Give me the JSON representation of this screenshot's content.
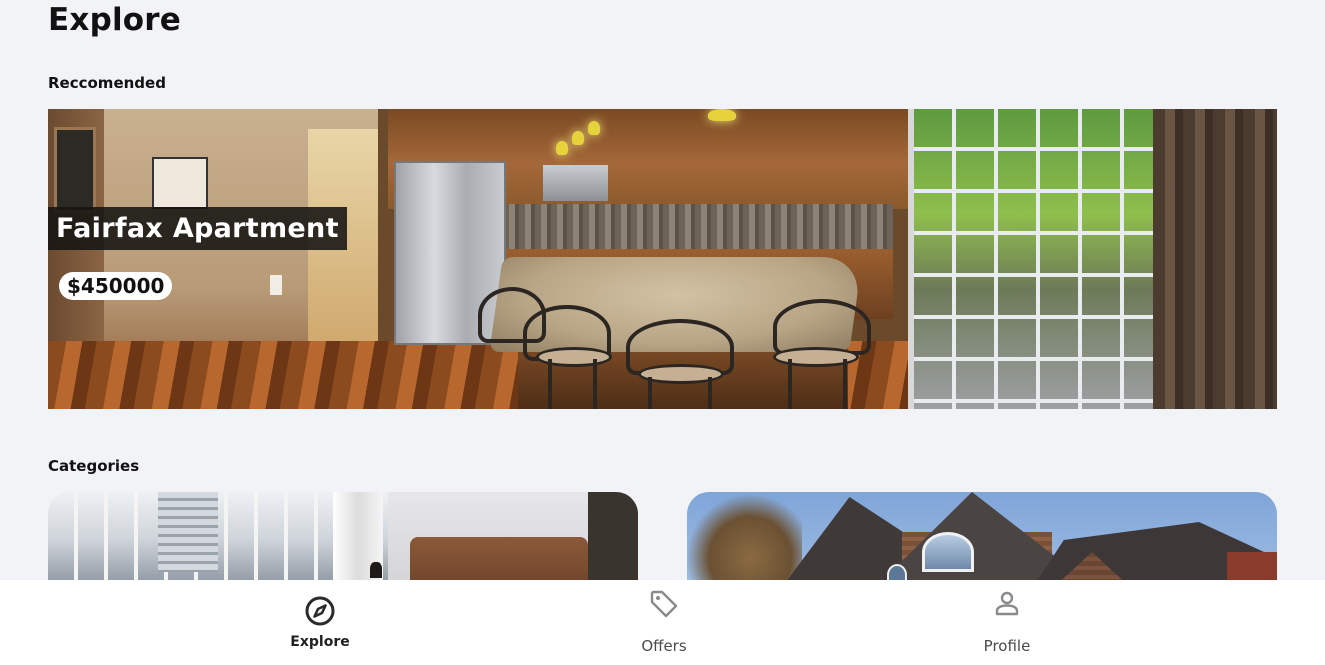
{
  "header": {
    "title": "Explore"
  },
  "sections": {
    "recommended_label": "Reccomended",
    "categories_label": "Categories"
  },
  "featured": {
    "name": "Fairfax Apartment",
    "price": "$450000"
  },
  "categories": [
    {
      "icon": "apartment-photo"
    },
    {
      "icon": "house-photo"
    }
  ],
  "nav": {
    "items": [
      {
        "label": "Explore",
        "icon": "compass-icon",
        "active": true
      },
      {
        "label": "Offers",
        "icon": "tag-icon",
        "active": false
      },
      {
        "label": "Profile",
        "icon": "user-icon",
        "active": false
      }
    ]
  },
  "colors": {
    "background": "#f2f3f7",
    "nav_background": "#ffffff",
    "active_icon": "#2b2b2b",
    "inactive_icon": "#8a8a8a"
  }
}
